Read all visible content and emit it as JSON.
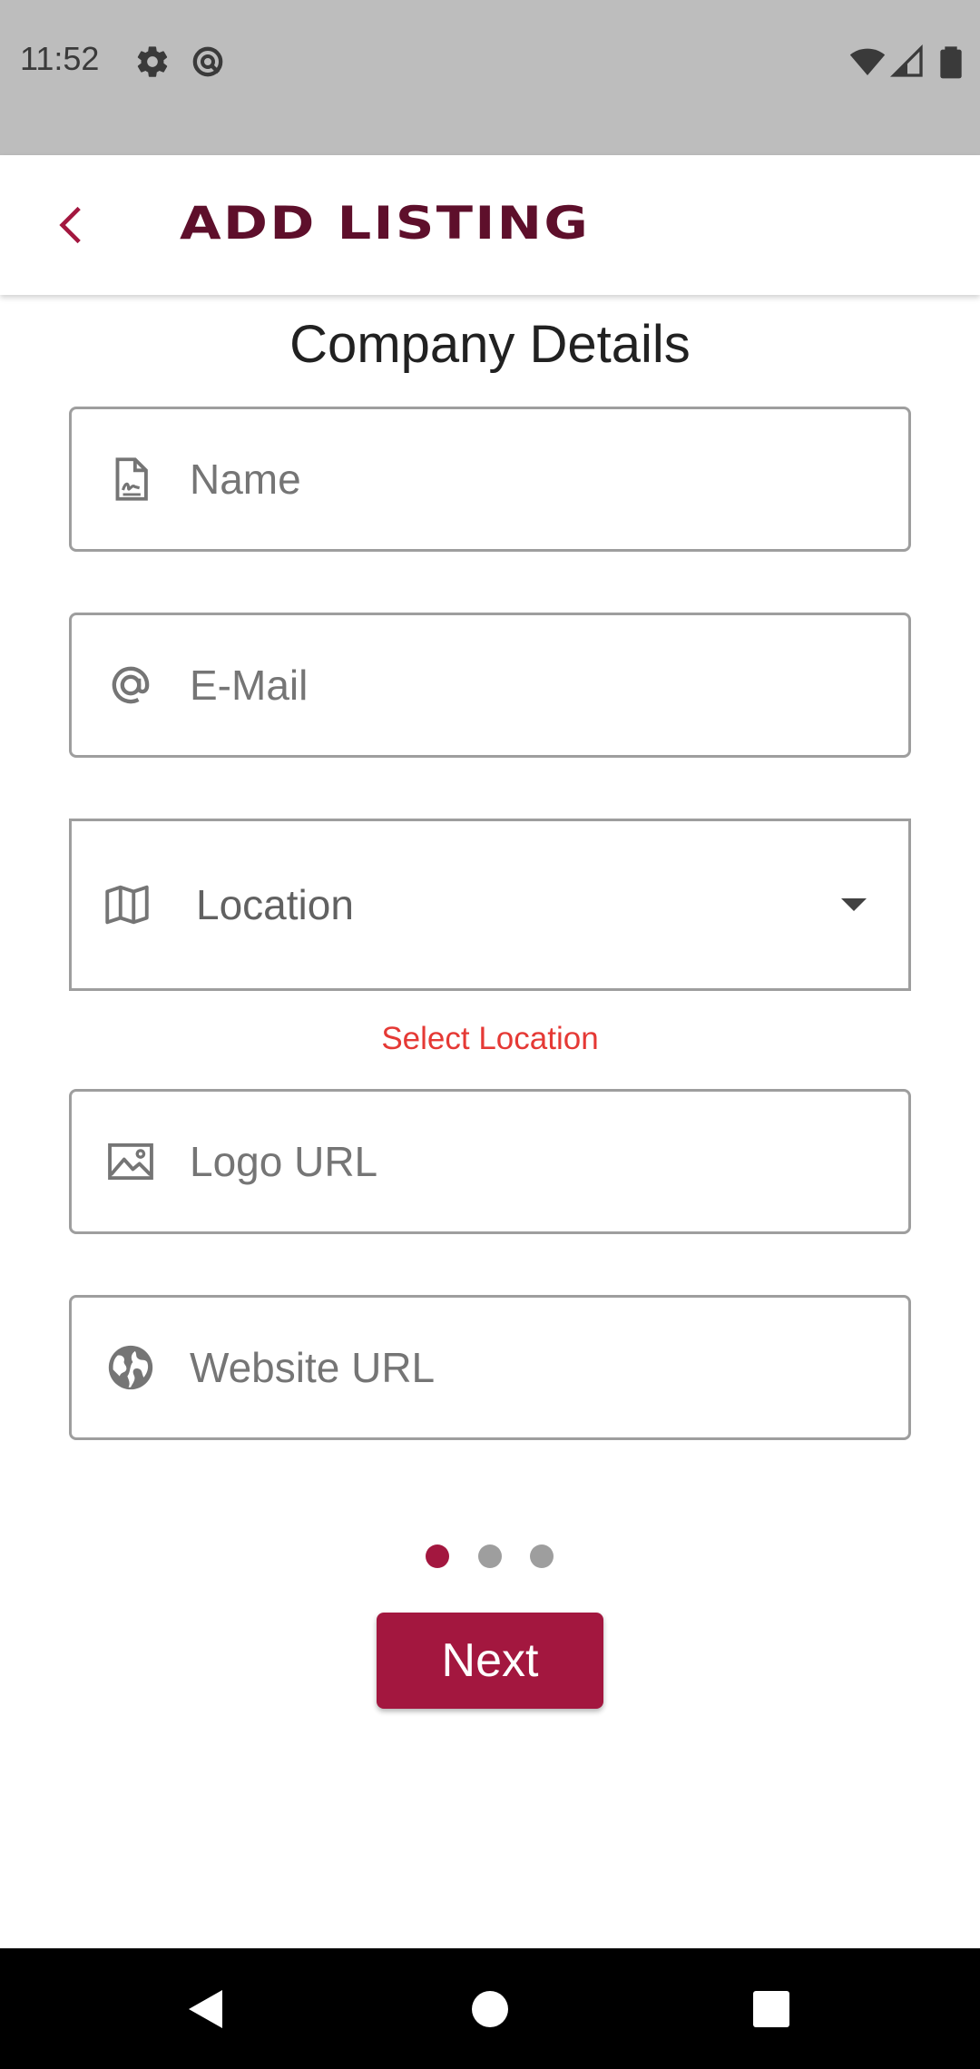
{
  "status_bar": {
    "time": "11:52",
    "icons": [
      "settings-icon",
      "data-saver-icon",
      "wifi-icon",
      "signal-icon",
      "battery-icon"
    ]
  },
  "app_bar": {
    "back_icon": "chevron-left-icon",
    "title": "ADD LISTING"
  },
  "form": {
    "section_title": "Company Details",
    "name": {
      "icon": "document-signature-icon",
      "placeholder": "Name",
      "value": ""
    },
    "email": {
      "icon": "at-sign-icon",
      "placeholder": "E-Mail",
      "value": ""
    },
    "location": {
      "icon": "map-icon",
      "selected": "Location",
      "error": "Select Location"
    },
    "logo_url": {
      "icon": "image-icon",
      "placeholder": "Logo URL",
      "value": ""
    },
    "website_url": {
      "icon": "globe-icon",
      "placeholder": "Website URL",
      "value": ""
    }
  },
  "pagination": {
    "total_steps": 3,
    "current_step": 1
  },
  "next_button": {
    "label": "Next"
  },
  "nav_bar": {
    "icons": [
      "back-triangle-icon",
      "home-circle-icon",
      "recents-square-icon"
    ]
  },
  "colors": {
    "brand_dark": "#5e0f2b",
    "accent": "#a3173f",
    "error": "#e53935",
    "inactive_dot": "#9e9e9e",
    "status_bar_bg": "#bdbdbd"
  }
}
